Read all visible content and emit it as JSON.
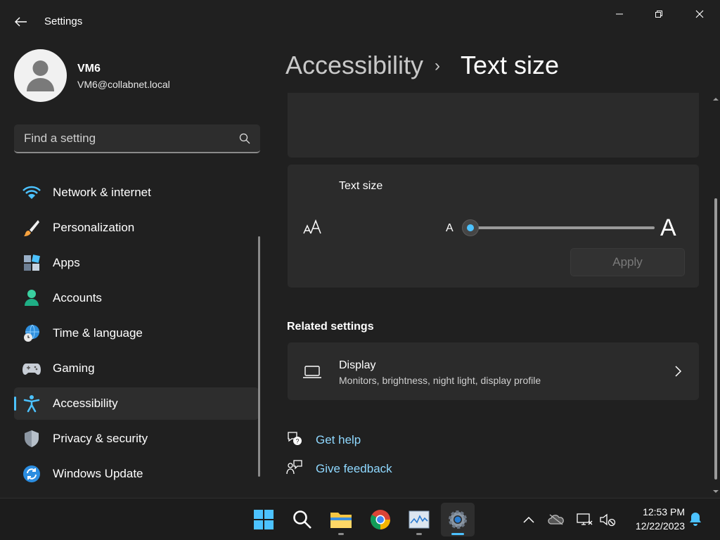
{
  "window": {
    "title": "Settings"
  },
  "user": {
    "name": "VM6",
    "email": "VM6@collabnet.local"
  },
  "search": {
    "placeholder": "Find a setting"
  },
  "sidebar": {
    "items": [
      {
        "label": "Network & internet",
        "icon": "wifi-icon"
      },
      {
        "label": "Personalization",
        "icon": "brush-icon"
      },
      {
        "label": "Apps",
        "icon": "apps-icon"
      },
      {
        "label": "Accounts",
        "icon": "accounts-icon"
      },
      {
        "label": "Time & language",
        "icon": "globe-clock-icon"
      },
      {
        "label": "Gaming",
        "icon": "gamepad-icon"
      },
      {
        "label": "Accessibility",
        "icon": "accessibility-icon",
        "selected": true
      },
      {
        "label": "Privacy & security",
        "icon": "shield-icon"
      },
      {
        "label": "Windows Update",
        "icon": "update-icon"
      }
    ]
  },
  "breadcrumb": {
    "parent": "Accessibility",
    "separator": "›",
    "current": "Text size"
  },
  "text_size": {
    "title": "Text size",
    "small_label": "A",
    "large_label": "A",
    "slider_level_percent": 0,
    "apply_label": "Apply",
    "apply_enabled": false
  },
  "related": {
    "title": "Related settings",
    "display": {
      "title": "Display",
      "subtitle": "Monitors, brightness, night light, display profile"
    }
  },
  "help": {
    "get_help": "Get help",
    "give_feedback": "Give feedback"
  },
  "taskbar": {
    "apps": [
      "start-icon",
      "search-icon",
      "file-explorer-icon",
      "chrome-icon",
      "task-manager-icon",
      "settings-icon"
    ],
    "time": "12:53 PM",
    "date": "12/22/2023"
  },
  "colors": {
    "accent": "#4cc2ff",
    "background": "#202020",
    "card": "#2b2b2b",
    "link": "#8fd8ff"
  }
}
